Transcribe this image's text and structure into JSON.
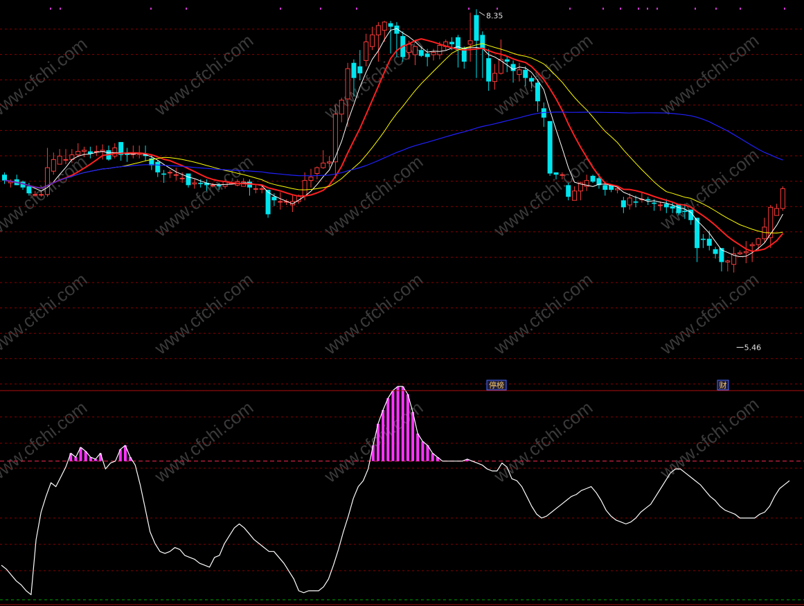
{
  "colors": {
    "background": "#000000",
    "up": "#ff3b3b",
    "down": "#00e5ee",
    "ma5": "#ffffff",
    "ma10": "#ff2020",
    "ma20": "#ffff00",
    "ma60": "#2020ff",
    "grid": "#8b0000",
    "osc_line": "#ffffff",
    "osc_bar": "#ff33ff",
    "threshold": "#cc2244",
    "zero": "#00aa00"
  },
  "labels": {
    "high": "8.35",
    "low": "5.46",
    "event_1": "停榜",
    "event_2": "财",
    "watermark": "www.cfchi.com"
  },
  "chart_data": [
    {
      "type": "candlestick",
      "ylim": [
        5.13,
        8.37
      ],
      "high_marker": 8.35,
      "low_marker": 5.46,
      "candles": [
        [
          6.93,
          6.88,
          6.95,
          6.85
        ],
        [
          6.86,
          6.87,
          6.89,
          6.82
        ],
        [
          6.89,
          6.84,
          6.93,
          6.84
        ],
        [
          6.87,
          6.82,
          6.88,
          6.8
        ],
        [
          6.83,
          6.77,
          6.86,
          6.75
        ],
        [
          6.76,
          6.76,
          6.79,
          6.74
        ],
        [
          6.76,
          6.76,
          6.79,
          6.74
        ],
        [
          6.76,
          6.99,
          7.16,
          6.74
        ],
        [
          6.96,
          7.06,
          7.12,
          6.93
        ],
        [
          7.02,
          7.09,
          7.15,
          7.02
        ],
        [
          7.06,
          7.06,
          7.15,
          7.02
        ],
        [
          7.06,
          7.1,
          7.15,
          7.03
        ],
        [
          7.1,
          7.13,
          7.2,
          7.08
        ],
        [
          7.13,
          7.14,
          7.17,
          7.08
        ],
        [
          7.13,
          7.11,
          7.17,
          7.07
        ],
        [
          7.13,
          7.13,
          7.18,
          7.09
        ],
        [
          7.13,
          7.14,
          7.19,
          7.06
        ],
        [
          7.14,
          7.06,
          7.18,
          7.05
        ],
        [
          7.09,
          7.16,
          7.2,
          7.07
        ],
        [
          7.21,
          7.1,
          7.21,
          7.05
        ],
        [
          7.12,
          7.1,
          7.16,
          7.04
        ],
        [
          7.11,
          7.11,
          7.18,
          7.07
        ],
        [
          7.11,
          7.11,
          7.18,
          7.07
        ],
        [
          7.11,
          7.09,
          7.18,
          7.05
        ],
        [
          7.07,
          7.01,
          7.1,
          6.97
        ],
        [
          7.04,
          6.95,
          7.05,
          6.91
        ],
        [
          6.94,
          6.93,
          6.97,
          6.86
        ],
        [
          6.95,
          6.95,
          6.97,
          6.9
        ],
        [
          6.93,
          6.93,
          6.99,
          6.88
        ],
        [
          6.9,
          6.9,
          6.95,
          6.86
        ],
        [
          6.94,
          6.84,
          6.94,
          6.82
        ],
        [
          6.85,
          6.86,
          6.89,
          6.81
        ],
        [
          6.86,
          6.85,
          6.89,
          6.82
        ],
        [
          6.86,
          6.84,
          6.89,
          6.79
        ],
        [
          6.84,
          6.84,
          6.86,
          6.82
        ],
        [
          6.84,
          6.83,
          6.86,
          6.8
        ],
        [
          6.83,
          6.87,
          6.89,
          6.81
        ],
        [
          6.86,
          6.86,
          6.87,
          6.85
        ],
        [
          6.84,
          6.87,
          6.89,
          6.83
        ],
        [
          6.83,
          6.87,
          6.9,
          6.83
        ],
        [
          6.87,
          6.82,
          6.89,
          6.75
        ],
        [
          6.81,
          6.81,
          6.84,
          6.77
        ],
        [
          6.81,
          6.81,
          6.84,
          6.77
        ],
        [
          6.8,
          6.59,
          6.8,
          6.56
        ],
        [
          6.74,
          6.71,
          6.77,
          6.66
        ],
        [
          6.7,
          6.7,
          6.78,
          6.63
        ],
        [
          6.7,
          6.7,
          6.72,
          6.67
        ],
        [
          6.67,
          6.7,
          6.76,
          6.61
        ],
        [
          6.7,
          6.75,
          6.76,
          6.68
        ],
        [
          6.75,
          6.88,
          6.95,
          6.71
        ],
        [
          6.88,
          6.91,
          6.98,
          6.82
        ],
        [
          6.94,
          6.99,
          7.0,
          6.89
        ],
        [
          6.99,
          7.03,
          7.14,
          6.98
        ],
        [
          7.03,
          7.04,
          7.09,
          6.99
        ],
        [
          7.04,
          7.45,
          7.53,
          6.9
        ],
        [
          7.45,
          7.57,
          7.59,
          7.38
        ],
        [
          7.58,
          7.84,
          7.89,
          7.34
        ],
        [
          7.89,
          7.76,
          7.92,
          7.6
        ],
        [
          7.86,
          7.8,
          8.0,
          7.74
        ],
        [
          7.91,
          8.07,
          8.14,
          7.86
        ],
        [
          8.03,
          8.13,
          8.2,
          8.0
        ],
        [
          8.13,
          8.21,
          8.24,
          7.9
        ],
        [
          8.17,
          8.24,
          8.25,
          8.07
        ],
        [
          8.23,
          8.2,
          8.25,
          7.97
        ],
        [
          8.21,
          8.14,
          8.24,
          7.94
        ],
        [
          8.12,
          7.94,
          8.16,
          7.9
        ],
        [
          7.98,
          8.05,
          8.08,
          7.92
        ],
        [
          7.96,
          8.03,
          8.03,
          7.87
        ],
        [
          8.0,
          7.95,
          8.03,
          7.94
        ],
        [
          7.97,
          7.94,
          8.01,
          7.86
        ],
        [
          7.96,
          7.98,
          8.01,
          7.91
        ],
        [
          7.96,
          8.04,
          8.07,
          7.92
        ],
        [
          8.03,
          8.07,
          8.09,
          8.0
        ],
        [
          8.07,
          8.05,
          8.11,
          8.0
        ],
        [
          8.11,
          8.0,
          8.13,
          7.85
        ],
        [
          8.02,
          7.9,
          8.03,
          7.84
        ],
        [
          8.05,
          8.08,
          8.32,
          7.9
        ],
        [
          8.3,
          8.08,
          8.35,
          7.76
        ],
        [
          8.13,
          8.01,
          8.16,
          7.76
        ],
        [
          7.93,
          7.73,
          8.01,
          7.65
        ],
        [
          7.73,
          7.8,
          7.88,
          7.66
        ],
        [
          7.8,
          7.92,
          8.09,
          7.79
        ],
        [
          7.92,
          7.9,
          7.95,
          7.81
        ],
        [
          7.88,
          7.82,
          7.91,
          7.72
        ],
        [
          7.79,
          7.83,
          7.89,
          7.73
        ],
        [
          7.83,
          7.76,
          7.86,
          7.69
        ],
        [
          7.76,
          7.73,
          7.78,
          7.67
        ],
        [
          7.72,
          7.56,
          7.75,
          7.47
        ],
        [
          7.5,
          7.42,
          7.55,
          7.34
        ],
        [
          7.39,
          6.94,
          7.39,
          6.92
        ],
        [
          6.95,
          6.93,
          6.95,
          6.89
        ],
        [
          6.93,
          6.93,
          6.95,
          6.89
        ],
        [
          6.84,
          6.74,
          6.86,
          6.71
        ],
        [
          6.71,
          6.79,
          6.83,
          6.71
        ],
        [
          6.79,
          6.86,
          6.87,
          6.71
        ],
        [
          6.83,
          6.88,
          6.93,
          6.79
        ],
        [
          6.92,
          6.87,
          6.93,
          6.86
        ],
        [
          6.9,
          6.84,
          6.94,
          6.81
        ],
        [
          6.84,
          6.8,
          6.87,
          6.75
        ],
        [
          6.84,
          6.8,
          6.84,
          6.78
        ],
        [
          6.8,
          6.81,
          6.82,
          6.77
        ],
        [
          6.71,
          6.65,
          6.74,
          6.6
        ],
        [
          6.67,
          6.73,
          6.77,
          6.63
        ],
        [
          6.7,
          6.69,
          6.75,
          6.65
        ],
        [
          6.72,
          6.72,
          6.78,
          6.69
        ],
        [
          6.72,
          6.71,
          6.74,
          6.67
        ],
        [
          6.69,
          6.68,
          6.72,
          6.62
        ],
        [
          6.67,
          6.67,
          6.7,
          6.62
        ],
        [
          6.68,
          6.65,
          6.72,
          6.6
        ],
        [
          6.66,
          6.64,
          6.69,
          6.6
        ],
        [
          6.68,
          6.6,
          6.66,
          6.58
        ],
        [
          6.62,
          6.61,
          6.68,
          6.55
        ],
        [
          6.63,
          6.54,
          6.63,
          6.5
        ],
        [
          6.56,
          6.3,
          6.56,
          6.18
        ],
        [
          6.38,
          6.37,
          6.42,
          6.3
        ],
        [
          6.38,
          6.32,
          6.45,
          6.28
        ],
        [
          6.29,
          6.25,
          6.31,
          6.21
        ],
        [
          6.3,
          6.18,
          6.3,
          6.1
        ],
        [
          6.18,
          6.19,
          6.2,
          6.1
        ],
        [
          6.16,
          6.25,
          6.31,
          6.09
        ],
        [
          6.25,
          6.26,
          6.28,
          6.24
        ],
        [
          6.26,
          6.27,
          6.36,
          6.17
        ],
        [
          6.32,
          6.33,
          6.35,
          6.18
        ],
        [
          6.33,
          6.38,
          6.39,
          6.28
        ],
        [
          6.38,
          6.48,
          6.56,
          6.35
        ],
        [
          6.39,
          6.65,
          6.67,
          6.3
        ],
        [
          6.58,
          6.64,
          6.68,
          6.59
        ],
        [
          6.64,
          6.81,
          6.83,
          6.62
        ]
      ],
      "ma": [
        {
          "name": "MA5",
          "period": 5
        },
        {
          "name": "MA10",
          "period": 10
        },
        {
          "name": "MA20",
          "period": 20
        },
        {
          "name": "MA60",
          "period": 60
        }
      ]
    },
    {
      "type": "line",
      "ylim": [
        -2,
        102
      ],
      "threshold": 70,
      "values": [
        17,
        15,
        12,
        9,
        7,
        4,
        2,
        30,
        44,
        52,
        59,
        57,
        62,
        67,
        74,
        72,
        77,
        75,
        72,
        71,
        74,
        66,
        69,
        70,
        76,
        78,
        72,
        68,
        58,
        46,
        34,
        28,
        24,
        23,
        24,
        26,
        25,
        22,
        21,
        20,
        18,
        17,
        16,
        21,
        22,
        28,
        32,
        36,
        38,
        36,
        33,
        30,
        28,
        26,
        24,
        24,
        21,
        18,
        14,
        10,
        4,
        3,
        4,
        4,
        4,
        6,
        10,
        17,
        25,
        34,
        42,
        51,
        57,
        60,
        66,
        78,
        89,
        96,
        102,
        106,
        108,
        108,
        104,
        95,
        84,
        80,
        78,
        74,
        72,
        70,
        70,
        70,
        70,
        70,
        71,
        70,
        69,
        68,
        66,
        65,
        65,
        69,
        67,
        61,
        60,
        57,
        52,
        47,
        43,
        41,
        42,
        44,
        46,
        48,
        50,
        52,
        53,
        55,
        56,
        57,
        54,
        50,
        45,
        42,
        40,
        39,
        38,
        39,
        41,
        44,
        46,
        48,
        52,
        56,
        60,
        64,
        66,
        66,
        64,
        62,
        60,
        58,
        55,
        52,
        50,
        47,
        45,
        44,
        43,
        41,
        41,
        41,
        41,
        43,
        44,
        47,
        52,
        56,
        58,
        60
      ]
    }
  ]
}
